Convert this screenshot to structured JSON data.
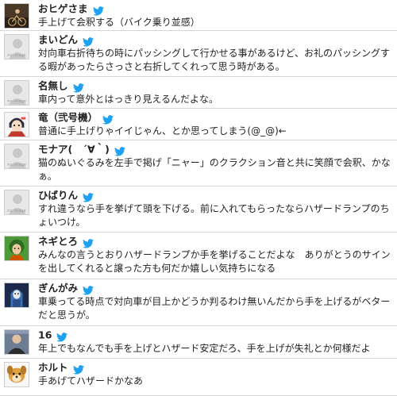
{
  "colors": {
    "twitter_blue": "#1da1f2",
    "divider": "#d7d7d7"
  },
  "icons": {
    "bird": "twitter-bird-icon",
    "noimage": "no-image-avatar"
  },
  "noimage_label": "no image",
  "comments": [
    {
      "name": "おヒゲさま",
      "avatar": "photo-dark-bike",
      "text": "手上げて会釈する（バイク乗り並感）"
    },
    {
      "name": "まいどん",
      "avatar": "no-image",
      "text": "対向車右折待ちの時にパッシングして行かせる事があるけど、お礼のパッシングする暇があったらさっさと右折してくれって思う時がある。"
    },
    {
      "name": "名無し",
      "avatar": "no-image",
      "text": "車内って意外とはっきり見えるんだよな。"
    },
    {
      "name": "竜（弐号機）",
      "avatar": "anime-character",
      "text": "普通に手上げりゃイイじゃん、とか思ってしまう(@_@)←"
    },
    {
      "name": "モナア(　´∀｀)",
      "avatar": "no-image",
      "text": "猫のぬいぐるみを左手で掲げ「ニャー」のクラクション音と共に笑顔で会釈、かなぁ。"
    },
    {
      "name": "ひばりん",
      "avatar": "no-image",
      "text": "すれ違うなら手を挙げて頭を下げる。前に入れてもらったならハザードランプのちょいつけ。"
    },
    {
      "name": "ネギとろ",
      "avatar": "green-character",
      "text": "みんなの言うとおりハザードランプか手を挙げることだよな　ありがとうのサインを出してくれると譲った方も何だか嬉しい気持ちになる"
    },
    {
      "name": "ぎんがみ",
      "avatar": "blue-character",
      "text": "車乗ってる時点で対向車が目上かどうか判るわけ無いんだから手を上げるがベターだと思うが。"
    },
    {
      "name": "16",
      "avatar": "photo-person",
      "text": "年上でもなんでも手を上げとハザード安定だろ、手を上げが失礼とか何様だよ"
    },
    {
      "name": "ホルト",
      "avatar": "dog-character",
      "text": "手あげてハザードかなあ"
    }
  ]
}
